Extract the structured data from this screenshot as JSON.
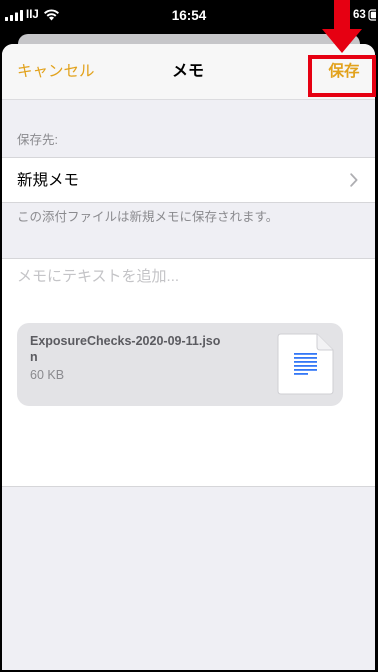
{
  "status_bar": {
    "carrier": "IIJ",
    "time": "16:54",
    "battery_percent": "63"
  },
  "nav": {
    "cancel_label": "キャンセル",
    "title": "メモ",
    "save_label": "保存"
  },
  "destination": {
    "section_header": "保存先:",
    "selected_note": "新規メモ",
    "footer_note": "この添付ファイルは新規メモに保存されます。"
  },
  "note": {
    "placeholder": "メモにテキストを追加..."
  },
  "attachment": {
    "filename_lines": [
      "ExposureChecks-2020-09-11.jso",
      "n"
    ],
    "size": "60 KB"
  },
  "icons": {
    "status_bar": [
      "cellular-signal-icon",
      "wifi-icon",
      "battery-icon"
    ],
    "destination_row": "chevron-right-icon",
    "attachment": "document-icon",
    "annotation": "red-down-arrow-icon"
  },
  "colors": {
    "accent": "#e2a21c",
    "annotation_red": "#e60012",
    "grouped_background": "#efeff4",
    "document_lines": "#3478f6"
  }
}
